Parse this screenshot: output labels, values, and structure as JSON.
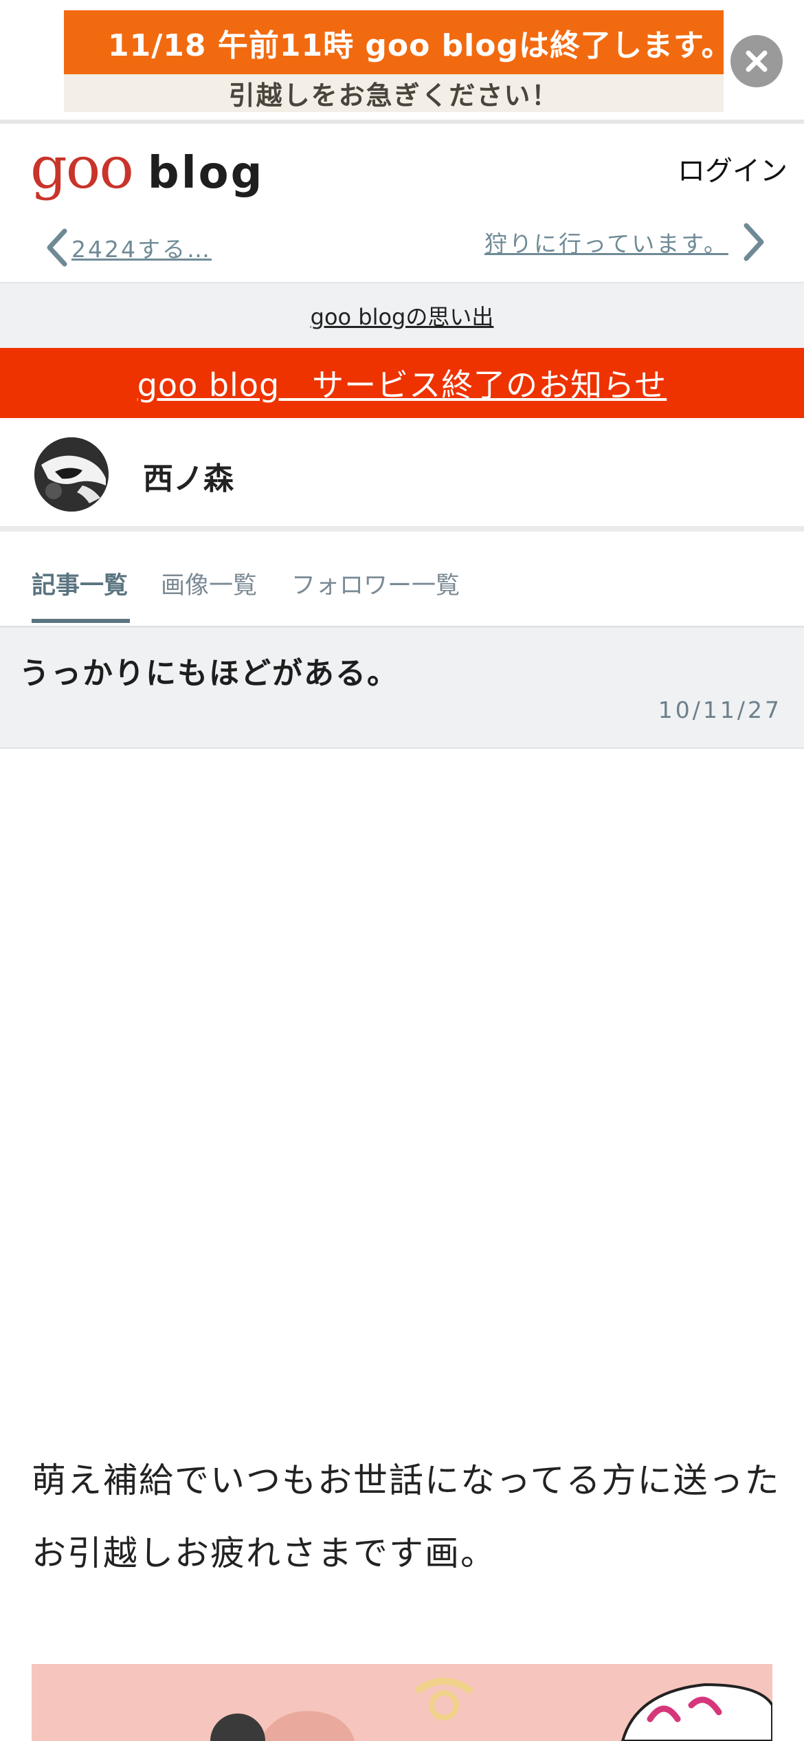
{
  "notice": {
    "title": "11/18 午前11時 goo blogは終了します。",
    "subtitle": "引越しをお急ぎください！"
  },
  "header": {
    "logo_goo": "goo",
    "logo_blog": "blog",
    "login_label": "ログイン"
  },
  "article_nav": {
    "prev_label": "2424する…",
    "next_label": "狩りに行っています。"
  },
  "memories_label": "goo blogの思い出",
  "end_notice_label": "goo blog　サービス終了のお知らせ",
  "profile": {
    "blog_name": "西ノ森"
  },
  "tabs": [
    {
      "label": "記事一覧",
      "active": true
    },
    {
      "label": "画像一覧",
      "active": false
    },
    {
      "label": "フォロワー一覧",
      "active": false
    }
  ],
  "article": {
    "title": "うっかりにもほどがある。",
    "date": "10/11/27",
    "body": "萌え補給でいつもお世話になってる方に送ったお引越しお疲れさまです画。"
  },
  "colors": {
    "notice_orange": "#f26a10",
    "end_notice_red": "#ee3300",
    "logo_red": "#c9342a",
    "accent_slate": "#5a7480"
  }
}
